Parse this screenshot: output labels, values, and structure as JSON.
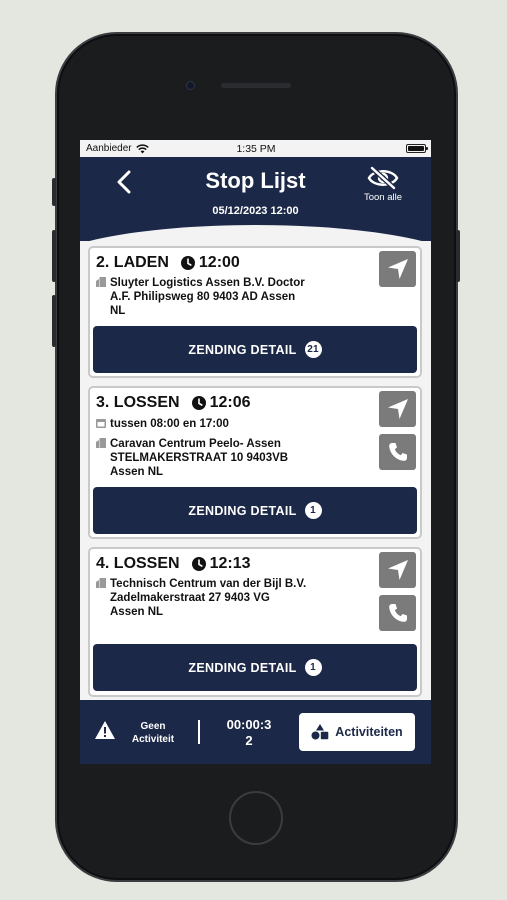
{
  "status_bar": {
    "carrier": "Aanbieder",
    "time": "1:35 PM"
  },
  "header": {
    "title": "Stop Lijst",
    "date": "05/12/2023 12:00",
    "toggle_label": "Toon alle"
  },
  "stops": [
    {
      "label": "2. LADEN",
      "time": "12:00",
      "address": [
        "Sluyter Logistics Assen B.V. Doctor",
        "A.F. Philipsweg 80 9403 AD Assen",
        "NL"
      ],
      "button_label": "ZENDING DETAIL",
      "count": "21"
    },
    {
      "label": "3. LOSSEN",
      "time": "12:06",
      "window": "tussen 08:00 en 17:00",
      "address": [
        "Caravan Centrum Peelo- Assen",
        "STELMAKERSTRAAT 10 9403VB",
        "Assen NL"
      ],
      "button_label": "ZENDING DETAIL",
      "count": "1"
    },
    {
      "label": "4. LOSSEN",
      "time": "12:13",
      "address": [
        "Technisch Centrum van der Bijl B.V.",
        "Zadelmakerstraat 27 9403 VG",
        "Assen NL"
      ],
      "button_label": "ZENDING DETAIL",
      "count": "1"
    }
  ],
  "footer": {
    "status_line1": "Geen",
    "status_line2": "Activiteit",
    "timer_line1": "00:00:3",
    "timer_line2": "2",
    "activities_label": "Activiteiten"
  },
  "colors": {
    "navy": "#1c2847",
    "action_gray": "#7b7b7b",
    "card_border": "#c9c9c9"
  },
  "icons": [
    "wifi-icon",
    "battery-icon",
    "back-chevron-icon",
    "eye-slash-icon",
    "clock-icon",
    "building-icon",
    "calendar-icon",
    "navigation-arrow-icon",
    "phone-icon",
    "warning-icon",
    "activities-icon"
  ]
}
